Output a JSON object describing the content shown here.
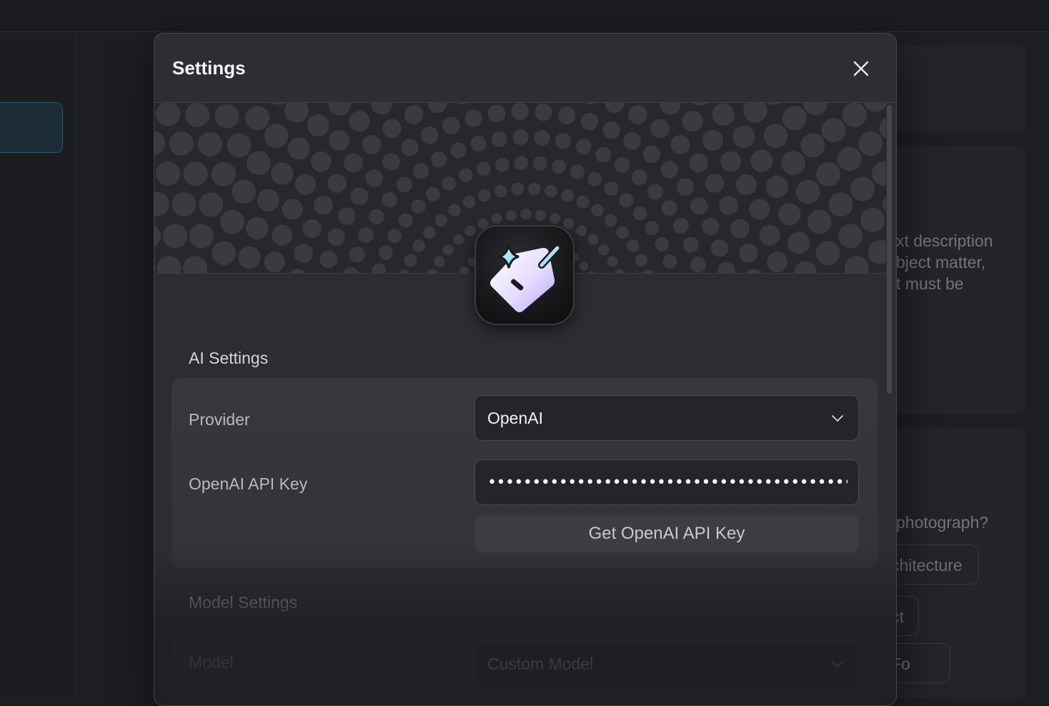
{
  "modal": {
    "title": "Settings"
  },
  "ai_settings": {
    "section_title": "AI Settings",
    "provider_label": "Provider",
    "provider_value": "OpenAI",
    "api_key_label": "OpenAI API Key",
    "api_key_value": "•••••••••••••••••••••••••••••••••••••••••••••••••••••",
    "get_key_button": "Get OpenAI API Key"
  },
  "model_settings": {
    "section_title": "Model Settings",
    "model_label": "Model",
    "model_value": "Custom Model"
  },
  "background": {
    "text_lines": [
      "xt description",
      "bject matter,",
      "t must be"
    ],
    "question": "photograph?",
    "pills": [
      "chitecture",
      "ct",
      "Fo"
    ]
  },
  "icons": {
    "close": "close-icon",
    "chevron": "chevron-down-icon",
    "app": "magic-tag-icon"
  },
  "colors": {
    "background": "#1d1e21",
    "modal": "#2c2d31",
    "accent_selected": "#2d5870"
  }
}
